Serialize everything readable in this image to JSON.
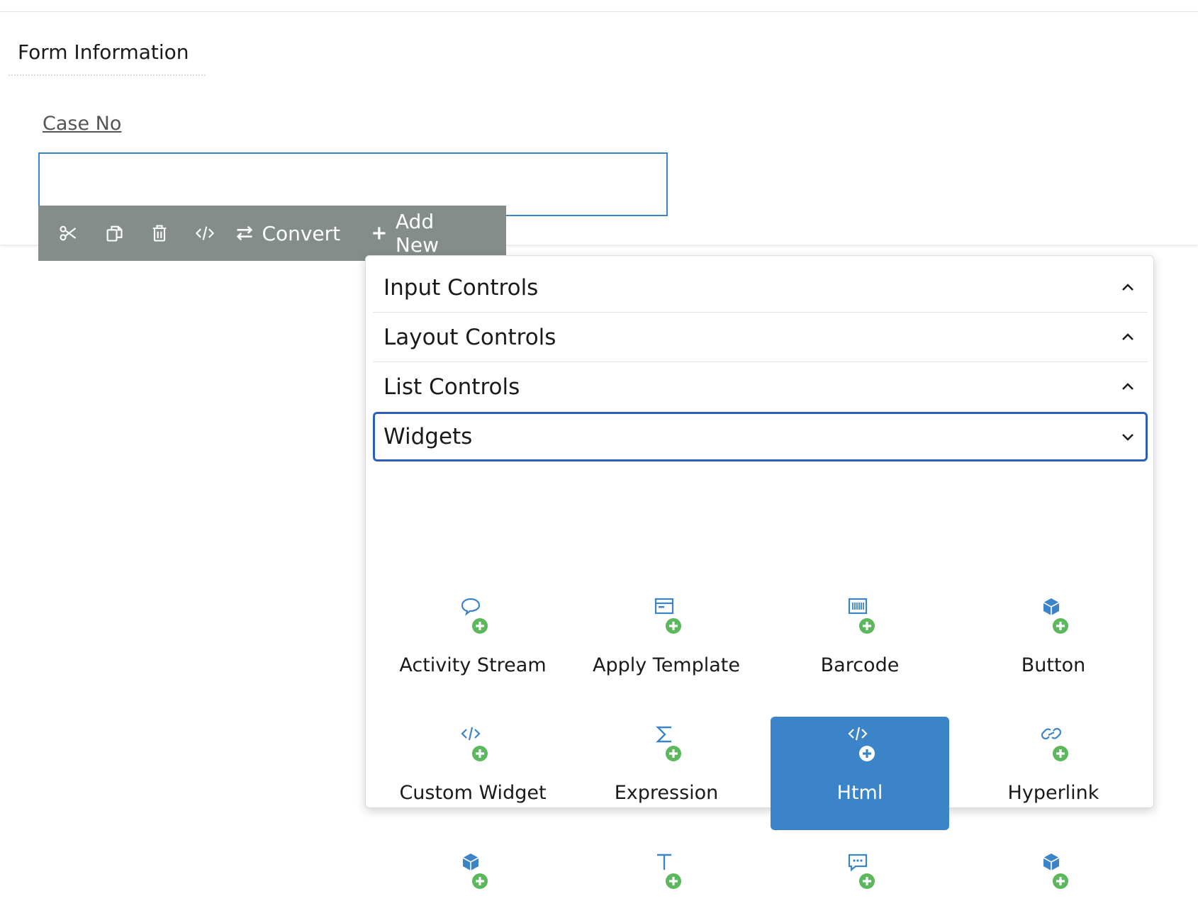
{
  "form": {
    "title": "Form Information",
    "field_label": "Case No",
    "field_value": ""
  },
  "toolbar": {
    "buttons": [
      {
        "icon": "scissors-icon",
        "label": ""
      },
      {
        "icon": "copy-icon",
        "label": ""
      },
      {
        "icon": "trash-icon",
        "label": ""
      },
      {
        "icon": "code-icon",
        "label": ""
      }
    ],
    "convert_label": "Convert",
    "add_new_label": "Add New"
  },
  "panel": {
    "sections": [
      {
        "label": "Input Controls",
        "state": "collapsed"
      },
      {
        "label": "Layout Controls",
        "state": "collapsed"
      },
      {
        "label": "List Controls",
        "state": "collapsed"
      },
      {
        "label": "Widgets",
        "state": "expanded"
      }
    ],
    "widgets": [
      {
        "label": "Activity Stream",
        "icon": "speech-bubble-icon",
        "selected": false
      },
      {
        "label": "Apply Template",
        "icon": "template-icon",
        "selected": false
      },
      {
        "label": "Barcode",
        "icon": "barcode-icon",
        "selected": false
      },
      {
        "label": "Button",
        "icon": "cube-icon",
        "selected": false
      },
      {
        "label": "Custom Widget",
        "icon": "code-icon",
        "selected": false
      },
      {
        "label": "Expression",
        "icon": "sigma-icon",
        "selected": false
      },
      {
        "label": "Html",
        "icon": "code-icon",
        "selected": true
      },
      {
        "label": "Hyperlink",
        "icon": "link-icon",
        "selected": false
      },
      {
        "label": "",
        "icon": "cube-icon",
        "selected": false
      },
      {
        "label": "",
        "icon": "text-icon",
        "selected": false
      },
      {
        "label": "",
        "icon": "chat-icon",
        "selected": false
      },
      {
        "label": "",
        "icon": "cube-icon",
        "selected": false
      }
    ]
  },
  "colors": {
    "accent_blue": "#3b84c8",
    "active_border": "#2d5fb8",
    "toolbar_bg": "#858d8b",
    "add_badge_green": "#5cb85c"
  }
}
